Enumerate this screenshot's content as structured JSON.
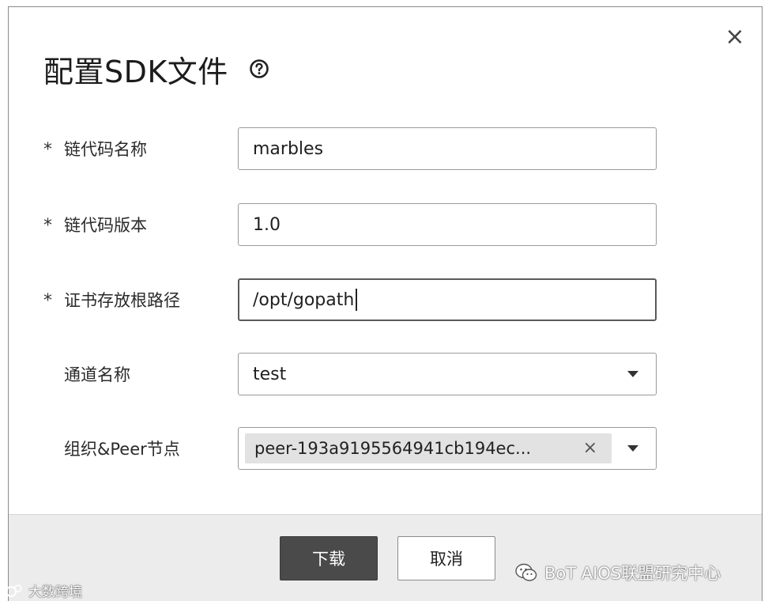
{
  "dialog": {
    "title": "配置SDK文件",
    "help_icon": "question-circle-icon",
    "close_icon": "close-icon",
    "close_glyph": "×"
  },
  "form": {
    "required_mark": "*",
    "chaincode_name": {
      "label": "链代码名称",
      "value": "marbles",
      "required": true
    },
    "chaincode_version": {
      "label": "链代码版本",
      "value": "1.0",
      "required": true
    },
    "cert_root_path": {
      "label": "证书存放根路径",
      "value": "/opt/gopath",
      "required": true
    },
    "channel_name": {
      "label": "通道名称",
      "value": "test",
      "required": false
    },
    "org_peer_nodes": {
      "label": "组织&Peer节点",
      "selected_tag": "peer-193a9195564941cb194ec...",
      "tag_remove_glyph": "×",
      "required": false
    }
  },
  "footer": {
    "download_label": "下载",
    "cancel_label": "取消"
  },
  "watermarks": {
    "right_text": "BoT AIOS联盟研究中心",
    "left_text": "大数跨境"
  }
}
